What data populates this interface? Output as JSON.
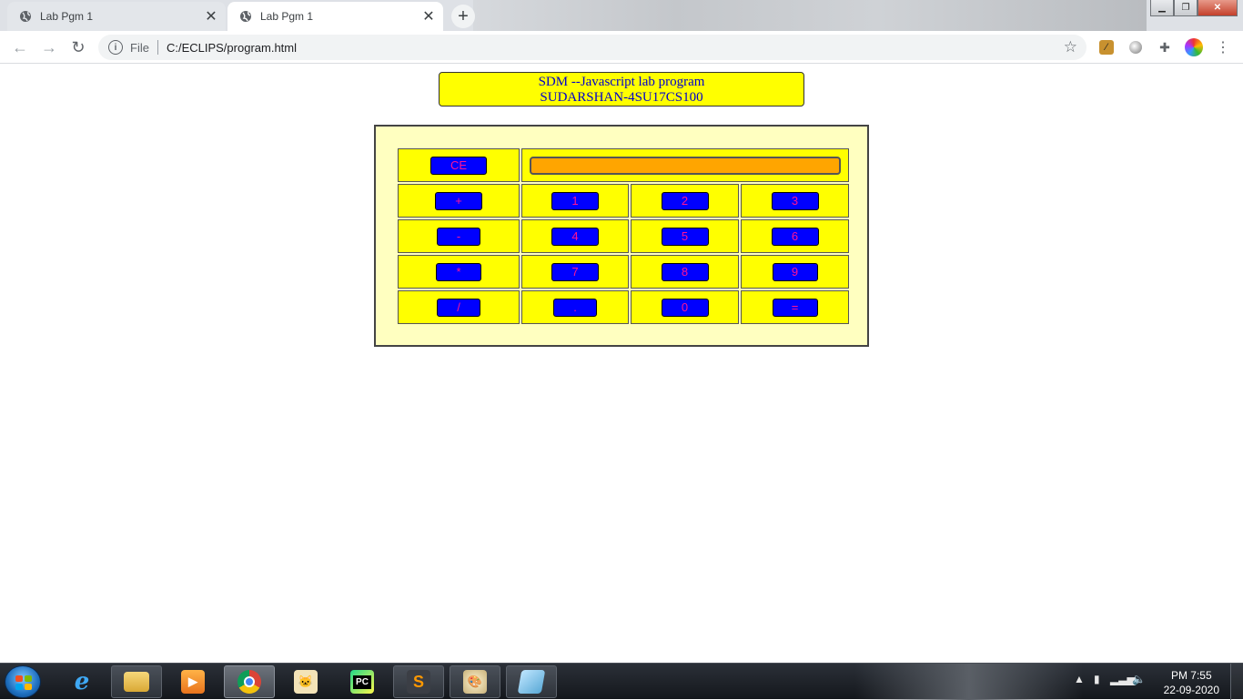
{
  "browser": {
    "tabs": [
      {
        "title": "Lab Pgm 1",
        "active": false
      },
      {
        "title": "Lab Pgm 1",
        "active": true
      }
    ],
    "address_scheme_label": "File",
    "address_url": "C:/ECLIPS/program.html",
    "window_controls": [
      "minimize-icon",
      "restore-icon",
      "close-icon"
    ]
  },
  "page": {
    "header_line1": "SDM --Javascript lab program",
    "header_line2": "SUDARSHAN-4SU17CS100",
    "colors": {
      "header_bg": "#ffff00",
      "header_text": "#0000cc",
      "panel_bg": "#ffffc0",
      "cell_bg": "#ffff00",
      "button_bg": "#0000ff",
      "button_text": "#ff1493",
      "display_bg": "#ffa500"
    },
    "calculator": {
      "clear_label": "CE",
      "display_value": "",
      "rows": [
        [
          "+",
          "1",
          "2",
          "3"
        ],
        [
          "-",
          "4",
          "5",
          "6"
        ],
        [
          "*",
          "7",
          "8",
          "9"
        ],
        [
          "/",
          ".",
          "0",
          "="
        ]
      ]
    }
  },
  "taskbar": {
    "apps": [
      "internet-explorer-icon",
      "file-explorer-icon",
      "media-player-icon",
      "chrome-icon",
      "tomcat-icon",
      "pycharm-icon",
      "sublime-text-icon",
      "paint-icon",
      "notepad-icon"
    ],
    "clock_time": "PM 7:55",
    "clock_date": "22-09-2020"
  }
}
